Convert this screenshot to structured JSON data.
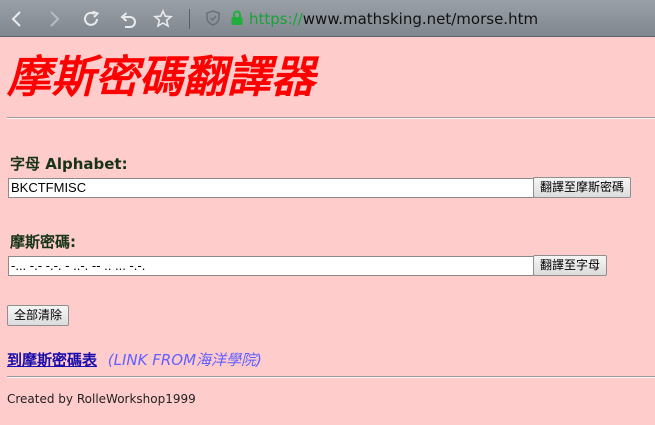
{
  "browser": {
    "url_scheme": "https://",
    "url_rest": "www.mathsking.net/morse.htm",
    "icons": [
      "back-icon",
      "forward-icon",
      "reload-icon",
      "undo-icon",
      "star-icon",
      "shield-icon",
      "lock-icon"
    ]
  },
  "page": {
    "title": "摩斯密碼翻譯器",
    "alphabet_label": "字母 Alphabet:",
    "alphabet_value": "BKCTFMISC",
    "to_morse_button": "翻譯至摩斯密碼",
    "morse_label": "摩斯密碼:",
    "morse_value": "-... -.- -.-. - ..-. -- .. ... -.-.",
    "to_alpha_button": "翻譯至字母",
    "clear_button": "全部清除",
    "link_text": "到摩斯密碼表",
    "link_source": "(LINK FROM海洋學院)",
    "footer": "Created by RolleWorkshop1999"
  },
  "colors": {
    "background": "#ffcccc",
    "title": "#ff0000",
    "link": "#1a0dab",
    "link_source": "#6060ff",
    "url_scheme": "#17a336"
  }
}
